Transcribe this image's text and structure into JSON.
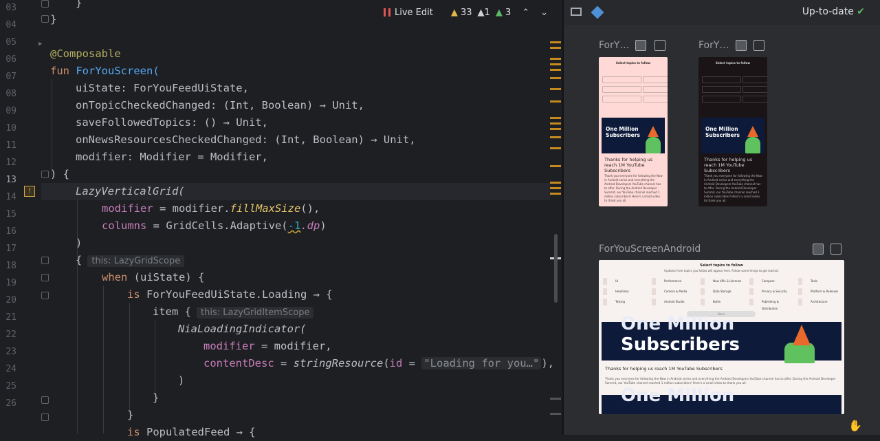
{
  "editor": {
    "line_numbers": [
      "03",
      "04",
      "05",
      "06",
      "07",
      "08",
      "09",
      "10",
      "11",
      "12",
      "13",
      "14",
      "15",
      "16",
      "17",
      "18",
      "19",
      "20",
      "21",
      "22",
      "23",
      "24",
      "25",
      "26"
    ],
    "code": {
      "l103": "}",
      "l105": "@Composable",
      "l106_kw": "fun",
      "l106_fn": "ForYouScreen(",
      "l107": "uiState: ForYouFeedUiState,",
      "l108": "onTopicCheckedChanged: (Int, Boolean) → Unit,",
      "l109": "saveFollowedTopics: () → Unit,",
      "l110": "onNewsResourcesCheckedChanged: (Int, Boolean) → Unit,",
      "l111": "modifier: Modifier = Modifier,",
      "l112": ") {",
      "l113": "LazyVerticalGrid(",
      "l114_param": "modifier",
      "l114_eq": " = modifier.",
      "l114_call": "fillMaxSize",
      "l114_end": "(),",
      "l115_param": "columns",
      "l115_eq": " = GridCells.Adaptive(",
      "l115_num": "-1",
      "l115_dp": ".dp",
      "l115_end": ")",
      "l116": ")",
      "l117": "{",
      "l117_hint": "this: LazyGridScope",
      "l118_kw": "when",
      "l118_rest": " (uiState) {",
      "l119_kw": "is",
      "l119_rest": " ForYouFeedUiState.Loading → {",
      "l120": "item {",
      "l120_hint": "this: LazyGridItemScope",
      "l121": "NiaLoadingIndicator(",
      "l122_param": "modifier",
      "l122_rest": " = modifier,",
      "l123_param": "contentDesc",
      "l123_eq": " = ",
      "l123_fn": "stringResource",
      "l123_open": "(",
      "l123_id": "id",
      "l123_eq2": " = ",
      "l123_str": "\"Loading for you…\"",
      "l123_end": "),",
      "l124": ")",
      "l125": "}",
      "l126": "}",
      "l127_kw": "is",
      "l127_rest": " PopulatedFeed → {"
    },
    "marker": "!"
  },
  "toolbar": {
    "live_edit": "Live Edit",
    "warnings": "33",
    "weak_warnings": "1",
    "typos": "3"
  },
  "preview": {
    "status": "Up-to-date",
    "preview1_title": "ForY…",
    "preview2_title": "ForY…",
    "preview3_title": "ForYouScreenAndroid",
    "phone": {
      "heading": "Select topics to follow",
      "sub": "Updates from topics you follow will appear here. Follow some things to get started.",
      "banner": "One Million Subscribers",
      "card_title": "Thanks for helping us reach 1M YouTube Subscribers",
      "card_body": "Thank you everyone for following the Now in Android series and everything the Android Developers YouTube channel has to offer. During the Android Developer Summit, our YouTube channel reached 1 million subscribers! Here's a small video to thank you all.",
      "done": "Done"
    },
    "wide": {
      "heading": "Select topics to follow",
      "sub": "Updates from topics you follow will appear here. Follow some things to get started.",
      "topics": [
        "UI",
        "Performance",
        "New APIs & Libraries",
        "Compose",
        "Tools",
        "Headlines",
        "Camera & Media",
        "Data Storage",
        "Privacy & Security",
        "Platform & Releases",
        "Testing",
        "Android Studio",
        "Kotlin",
        "Publishing & Distribution",
        "Architecture"
      ],
      "banner1": "One Million",
      "banner2": "Subscribers",
      "card_title": "Thanks for helping us reach 1M YouTube Subscribers",
      "card_body": "Thank you everyone for following the Now in Android series and everything the Android Developers YouTube channel has to offer. During the Android Developer Summit, our YouTube channel reached 1 million subscribers! Here's a small video to thank you all.",
      "done": "Done"
    }
  },
  "colors": {
    "accent_warning": "#e0b84a",
    "accent_ok": "#5fb865",
    "live_edit_pause": "#e05555"
  }
}
